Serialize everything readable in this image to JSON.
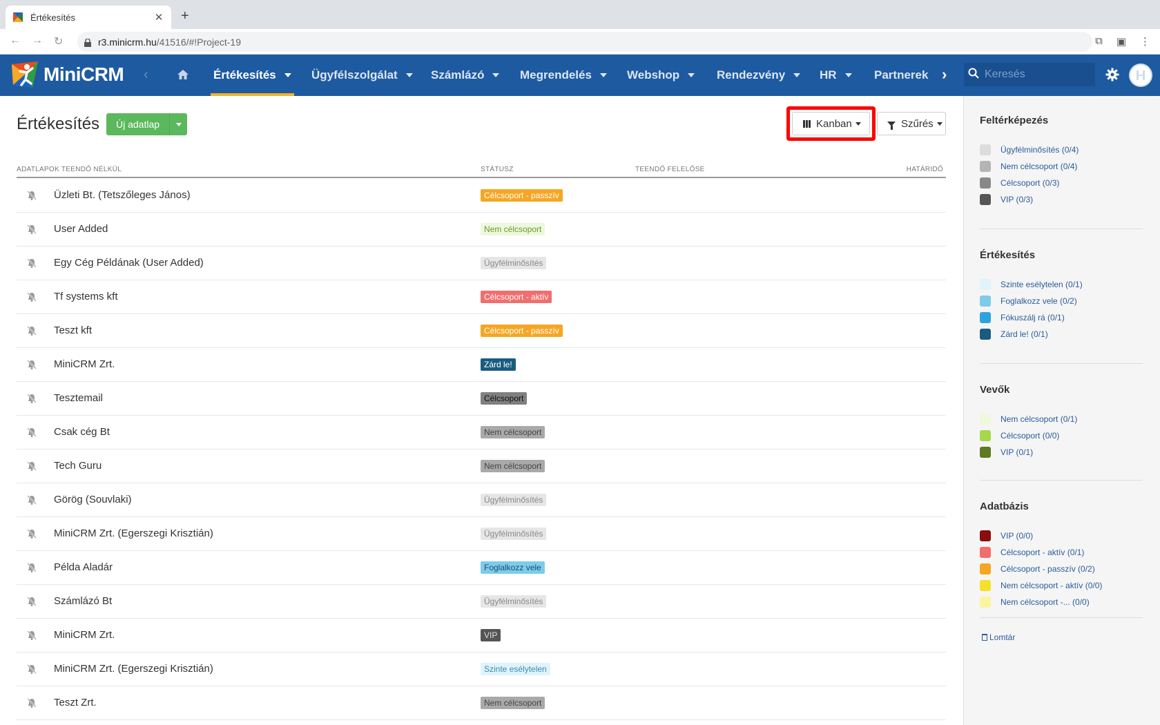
{
  "browser": {
    "tab_title": "Értékesítés",
    "url_host": "r3.minicrm.hu",
    "url_path": "/41516/#!Project-19"
  },
  "header": {
    "logo_text": "MiniCRM",
    "menu": [
      {
        "label": "Értékesítés",
        "active": true
      },
      {
        "label": "Ügyfélszolgálat"
      },
      {
        "label": "Számlázó"
      },
      {
        "label": "Megrendelés"
      },
      {
        "label": "Webshop"
      },
      {
        "label": "Rendezvény"
      },
      {
        "label": "HR"
      },
      {
        "label": "Partnerek"
      }
    ],
    "search_placeholder": "Keresés"
  },
  "main": {
    "title": "Értékesítés",
    "new_button": "Új adatlap",
    "view_button": "Kanban",
    "filter_button": "Szűrés",
    "columns": {
      "name": "ADATLAPOK TEENDŐ NÉLKÜL",
      "status": "STÁTUSZ",
      "owner": "TEENDŐ FELELŐSE",
      "deadline": "HATÁRIDŐ"
    },
    "rows": [
      {
        "name": "Üzleti Bt. (Tetszőleges János)",
        "status": "Célcsoport - passzív",
        "bg": "#f5a623",
        "fg": "#fff"
      },
      {
        "name": "User Added",
        "status": "Nem célcsoport",
        "bg": "#eef8dc",
        "fg": "#6a9a2a"
      },
      {
        "name": "Egy Cég Példának (User Added)",
        "status": "Ügyfélminősítés",
        "bg": "#e6e6e6",
        "fg": "#888"
      },
      {
        "name": "Tf systems kft",
        "status": "Célcsoport - aktív",
        "bg": "#f26d6d",
        "fg": "#fff"
      },
      {
        "name": "Teszt kft",
        "status": "Célcsoport - passzív",
        "bg": "#f5a623",
        "fg": "#fff"
      },
      {
        "name": "MiniCRM Zrt.",
        "status": "Zárd le!",
        "bg": "#1a5c80",
        "fg": "#fff"
      },
      {
        "name": "Tesztemail",
        "status": "Célcsoport",
        "bg": "#808080",
        "fg": "#111"
      },
      {
        "name": "Csak cég Bt",
        "status": "Nem célcsoport",
        "bg": "#a9a9a9",
        "fg": "#444"
      },
      {
        "name": "Tech Guru",
        "status": "Nem célcsoport",
        "bg": "#a9a9a9",
        "fg": "#444"
      },
      {
        "name": "Görög (Souvlaki)",
        "status": "Ügyfélminősítés",
        "bg": "#e6e6e6",
        "fg": "#888"
      },
      {
        "name": "MiniCRM Zrt. (Egerszegi Krisztián)",
        "status": "Ügyfélminősítés",
        "bg": "#e6e6e6",
        "fg": "#888"
      },
      {
        "name": "Példa Aladár",
        "status": "Foglalkozz vele",
        "bg": "#7ecbea",
        "fg": "#1a4f6f"
      },
      {
        "name": "Számlázó Bt",
        "status": "Ügyfélminősítés",
        "bg": "#e6e6e6",
        "fg": "#888"
      },
      {
        "name": "MiniCRM Zrt.",
        "status": "VIP",
        "bg": "#555555",
        "fg": "#ddd"
      },
      {
        "name": "MiniCRM Zrt. (Egerszegi Krisztián)",
        "status": "Szinte esélytelen",
        "bg": "#dff3fb",
        "fg": "#3a8ab5"
      },
      {
        "name": "Teszt Zrt.",
        "status": "Nem célcsoport",
        "bg": "#a9a9a9",
        "fg": "#444"
      }
    ]
  },
  "sidebar": {
    "sections": [
      {
        "title": "Feltérképezés",
        "items": [
          {
            "label": "Ügyfélminősítés (0/4)",
            "color": "#dcdcdc"
          },
          {
            "label": "Nem célcsoport (0/4)",
            "color": "#b4b4b4"
          },
          {
            "label": "Célcsoport (0/3)",
            "color": "#888888"
          },
          {
            "label": "VIP (0/3)",
            "color": "#555555"
          }
        ]
      },
      {
        "title": "Értékesítés",
        "items": [
          {
            "label": "Szinte esélytelen (0/1)",
            "color": "#dff3fb"
          },
          {
            "label": "Foglalkozz vele (0/2)",
            "color": "#7ecbea"
          },
          {
            "label": "Fókuszálj rá (0/1)",
            "color": "#2ea3dd"
          },
          {
            "label": "Zárd le! (0/1)",
            "color": "#1a5c80"
          }
        ]
      },
      {
        "title": "Vevők",
        "items": [
          {
            "label": "Nem célcsoport (0/1)",
            "color": "#eef8dc"
          },
          {
            "label": "Célcsoport (0/0)",
            "color": "#a6d84a"
          },
          {
            "label": "VIP (0/1)",
            "color": "#5e7a22"
          }
        ]
      },
      {
        "title": "Adatbázis",
        "items": [
          {
            "label": "VIP (0/0)",
            "color": "#8b0d0d"
          },
          {
            "label": "Célcsoport - aktív (0/1)",
            "color": "#f26d6d"
          },
          {
            "label": "Célcsoport - passzív (0/2)",
            "color": "#f5a623"
          },
          {
            "label": "Nem célcsoport - aktív (0/0)",
            "color": "#f5e02a"
          },
          {
            "label": "Nem célcsoport -... (0/0)",
            "color": "#faf5a0"
          }
        ]
      }
    ],
    "trash_label": "Lomtár"
  }
}
